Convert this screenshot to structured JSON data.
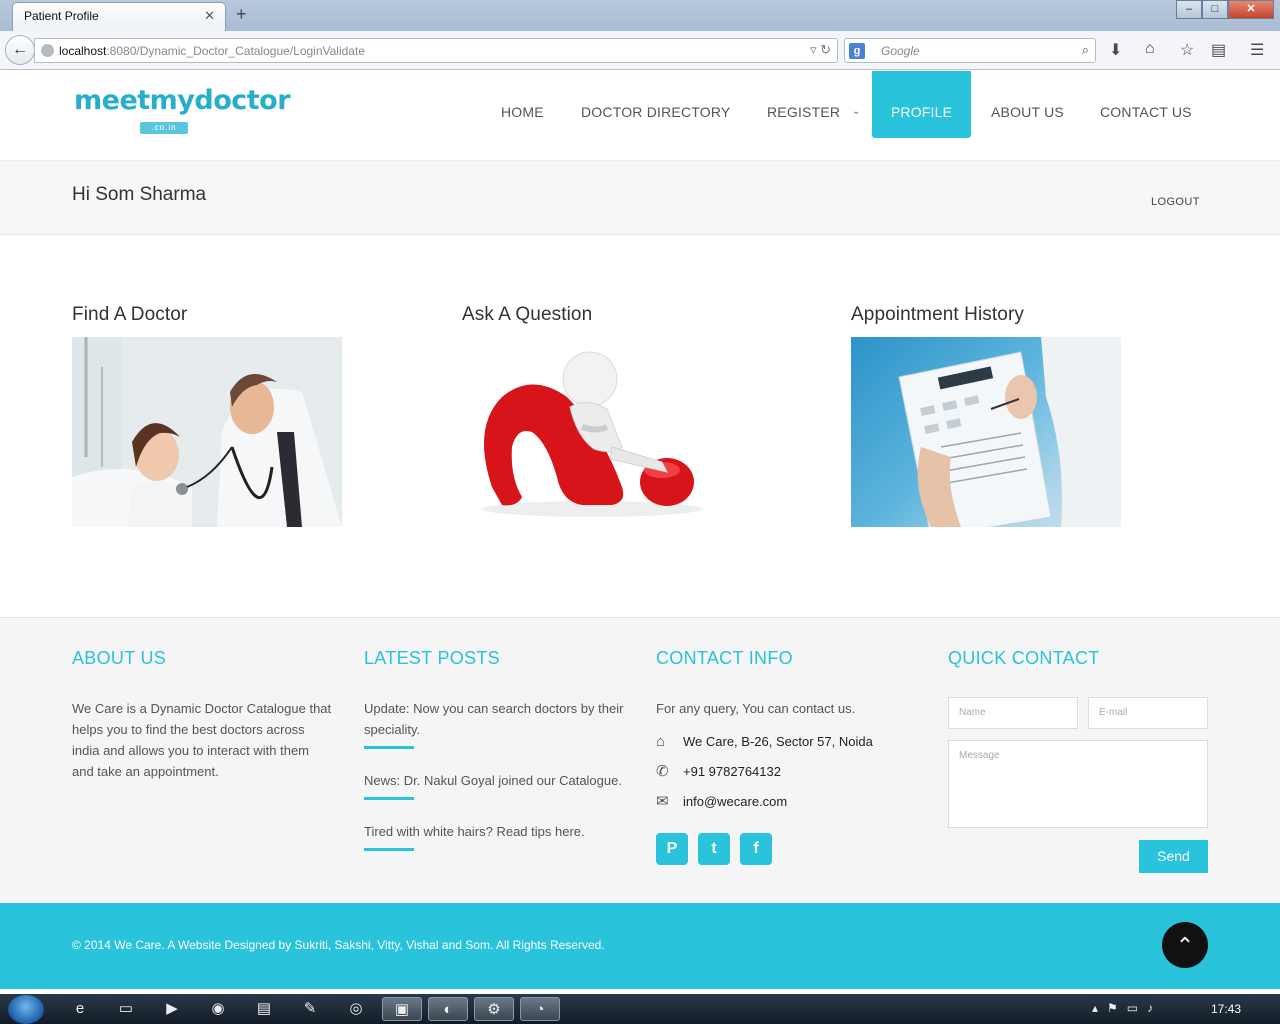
{
  "browser": {
    "tab_title": "Patient Profile",
    "url_host": "localhost",
    "url_rest": ":8080/Dynamic_Doctor_Catalogue/LoginValidate",
    "search_engine": "Google"
  },
  "site": {
    "logo_text": "meetmydoctor",
    "logo_sub": ".co.in",
    "nav": [
      "HOME",
      "DOCTOR DIRECTORY",
      "REGISTER",
      "PROFILE",
      "ABOUT US",
      "CONTACT US"
    ],
    "active_nav": "PROFILE",
    "accent_color": "#29c3db"
  },
  "greeting": {
    "text": "Hi Som Sharma",
    "logout": "LOGOUT"
  },
  "cards": [
    {
      "title": "Find A Doctor",
      "image": "doctor-examining-child"
    },
    {
      "title": "Ask A Question",
      "image": "figure-on-red-question-mark"
    },
    {
      "title": "Appointment History",
      "image": "clipboard-and-calculator"
    }
  ],
  "footer": {
    "about": {
      "heading": "ABOUT US",
      "text": "We Care is a Dynamic Doctor Catalogue that helps you to find the best doctors across india and allows you to interact with them and take an appointment."
    },
    "posts": {
      "heading": "LATEST POSTS",
      "items": [
        "Update: Now you can search doctors by their speciality.",
        "News: Dr. Nakul Goyal joined our Catalogue.",
        "Tired with white hairs? Read tips here."
      ]
    },
    "contact": {
      "heading": "CONTACT INFO",
      "intro": "For any query, You can contact us.",
      "address": "We Care, B-26, Sector 57, Noida",
      "phone": "+91 9782764132",
      "email": "info@wecare.com",
      "socials": [
        "pinterest-icon",
        "twitter-icon",
        "facebook-icon"
      ]
    },
    "quick_contact": {
      "heading": "QUICK CONTACT",
      "name_placeholder": "Name",
      "email_placeholder": "E-mail",
      "message_placeholder": "Message",
      "send": "Send"
    },
    "copyright": "© 2014 We Care. A Website Designed by Sukriti, Sakshi, Vitty, Vishal and Som. All Rights Reserved."
  },
  "taskbar": {
    "clock": "17:43"
  }
}
